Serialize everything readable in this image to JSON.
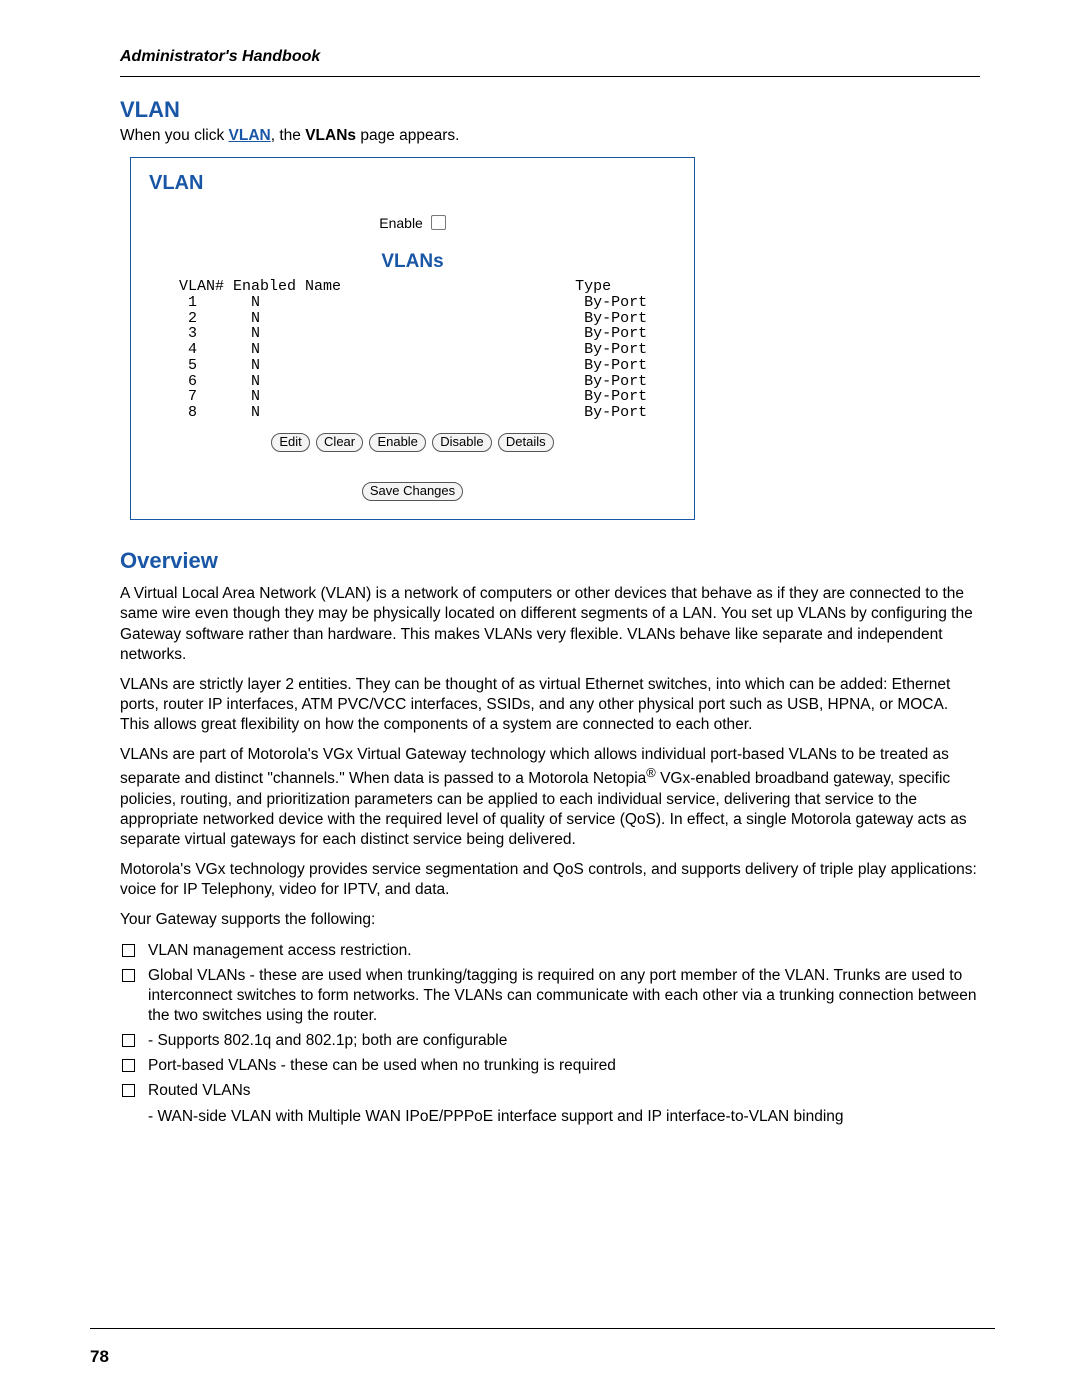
{
  "header": "Administrator's Handbook",
  "section1_title": "VLAN",
  "intro_prefix": "When you click ",
  "intro_link": "VLAN",
  "intro_mid": ", the ",
  "intro_bold": "VLANs",
  "intro_suffix": " page appears.",
  "panel": {
    "title": "VLAN",
    "enable_label": "Enable",
    "table_title": "VLANs",
    "columns": {
      "c1": "VLAN#",
      "c2": "Enabled",
      "c3": "Name",
      "c4": "Type"
    },
    "rows": [
      {
        "num": "1",
        "enabled": "N",
        "name": "",
        "type": "By-Port"
      },
      {
        "num": "2",
        "enabled": "N",
        "name": "",
        "type": "By-Port"
      },
      {
        "num": "3",
        "enabled": "N",
        "name": "",
        "type": "By-Port"
      },
      {
        "num": "4",
        "enabled": "N",
        "name": "",
        "type": "By-Port"
      },
      {
        "num": "5",
        "enabled": "N",
        "name": "",
        "type": "By-Port"
      },
      {
        "num": "6",
        "enabled": "N",
        "name": "",
        "type": "By-Port"
      },
      {
        "num": "7",
        "enabled": "N",
        "name": "",
        "type": "By-Port"
      },
      {
        "num": "8",
        "enabled": "N",
        "name": "",
        "type": "By-Port"
      }
    ],
    "buttons": {
      "edit": "Edit",
      "clear": "Clear",
      "enable": "Enable",
      "disable": "Disable",
      "details": "Details",
      "save": "Save Changes"
    }
  },
  "overview_title": "Overview",
  "p1": "A Virtual Local Area Network (VLAN) is a network of computers or other devices that behave as if they are connected to the same wire even though they may be physically located on different segments of a LAN. You set up VLANs by configuring the Gateway software rather than hardware. This makes VLANs very flexible. VLANs behave like separate and independent networks.",
  "p2": "VLANs are strictly layer 2 entities. They can be thought of as virtual Ethernet switches, into which can be added: Ethernet ports, router IP interfaces, ATM PVC/VCC interfaces, SSIDs, and any other physical port such as USB, HPNA, or MOCA. This allows great flexibility on how the components of a system are connected to each other.",
  "p3a": "VLANs are part of Motorola's VGx Virtual Gateway technology which allows individual port-based VLANs to be treated as separate and distinct \"channels.\" When data is passed to a Motorola Netopia",
  "p3_reg": "®",
  "p3b": " VGx-enabled broadband gateway, specific policies, routing, and prioritization parameters can be applied to each individual service, delivering that service to the appropriate networked device with the required level of quality of service (QoS). In effect, a single Motorola gateway acts as separate virtual gateways for each distinct service being delivered.",
  "p4": "Motorola's VGx technology provides service segmentation and QoS controls, and supports delivery of triple play applications: voice for IP Telephony, video for IPTV, and data.",
  "p5": "Your Gateway supports the following:",
  "bullets": [
    "VLAN management access restriction.",
    "Global VLANs - these are used when trunking/tagging is required on any port member of the VLAN. Trunks are used to interconnect switches to form networks. The VLANs can communicate with each other via a trunking connection between the two switches using the router.",
    " - Supports 802.1q and 802.1p; both are configurable",
    "Port-based VLANs - these can be used when no trunking is required",
    "Routed VLANs"
  ],
  "sub_bullet": " - WAN-side VLAN with Multiple WAN IPoE/PPPoE interface support and IP interface-to-VLAN binding",
  "page_number": "78"
}
